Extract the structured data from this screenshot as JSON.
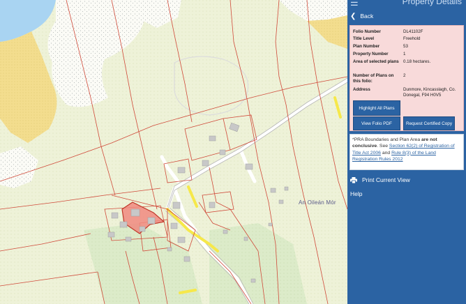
{
  "panel": {
    "title": "Property Details",
    "back_label": "Back",
    "details": [
      {
        "label": "Folio Number",
        "value": "DL41102F"
      },
      {
        "label": "Title Level",
        "value": "Freehold"
      },
      {
        "label": "Plan Number",
        "value": "53"
      },
      {
        "label": "Property Number",
        "value": "1"
      },
      {
        "label": "Area of selected plans",
        "value": "0.18 hectares."
      },
      {
        "label": "Number of Plans on this folio:",
        "value": "2"
      },
      {
        "label": "Address",
        "value": "Dunmore, Kincasslagh, Co. Donegal, F94 H0V5"
      }
    ],
    "buttons": {
      "highlight": "Highlight All Plans",
      "view_pdf": "View Folio PDF",
      "certified": "Request Certified Copy"
    },
    "note": {
      "prefix": "*PRA Boundaries and Plan Area ",
      "bold": "are not conclusive",
      "mid": ". See ",
      "link1": "Section 62(2) of Registration of Title Act 2006",
      "and": " and ",
      "link2": "Rule 8(3) of the Land Registration Rules 2012"
    },
    "print_label": "Print Current View",
    "help_label": "Help"
  },
  "map": {
    "place_label": "An Oileán Mór"
  },
  "colors": {
    "panel_bg": "#2b63a3",
    "details_bg": "#f8dada",
    "parcel_outline": "#c0392b",
    "selected_fill": "#f08a80",
    "road_yellow": "#f6e84a",
    "water": "#a9d4f2",
    "sand": "#f2dc8e"
  }
}
